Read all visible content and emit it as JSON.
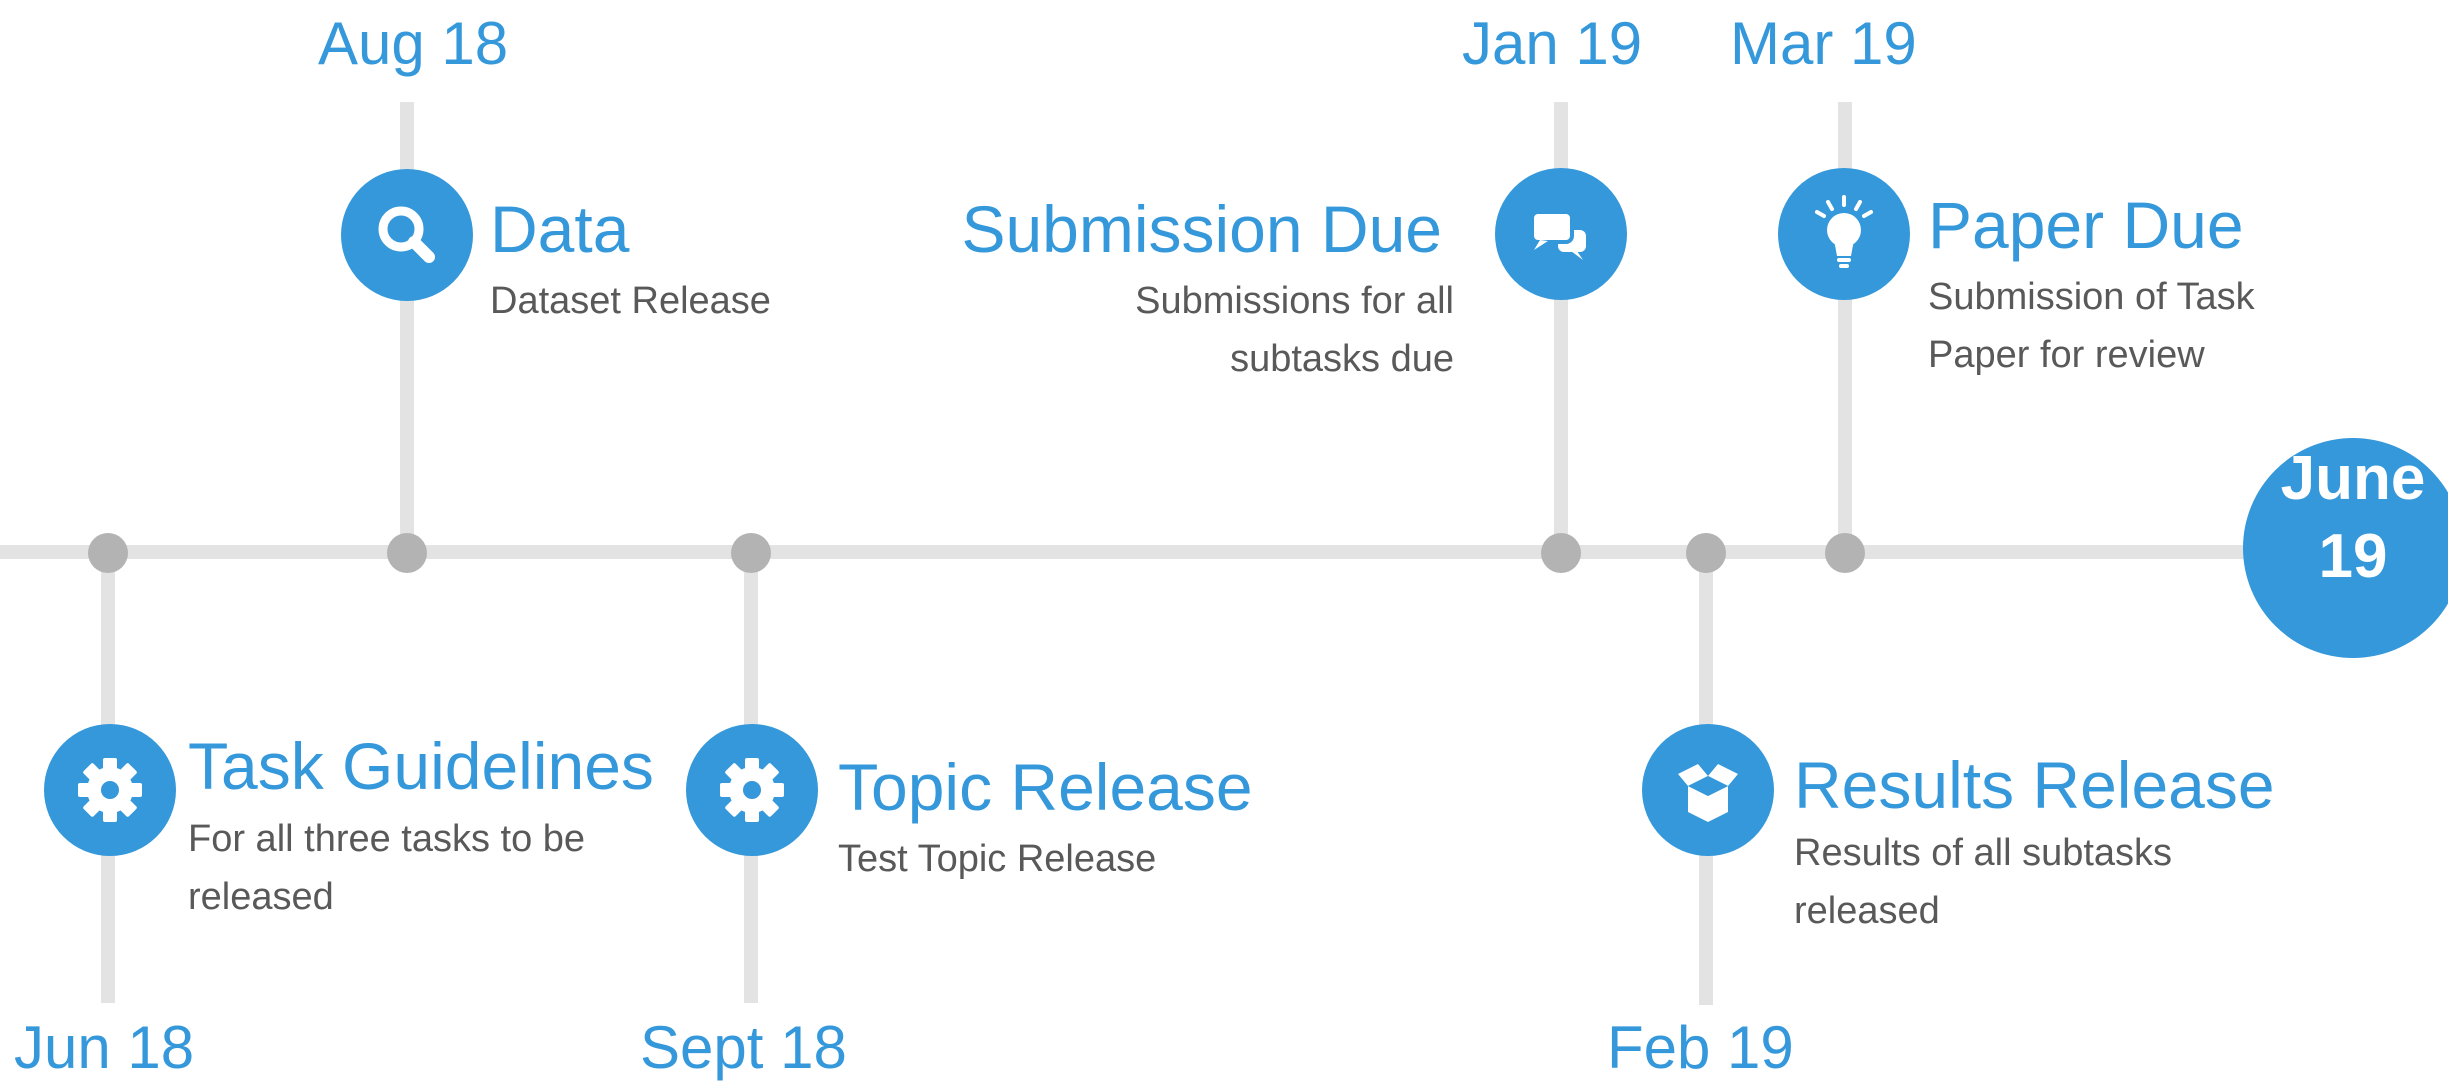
{
  "timeline": {
    "events": [
      {
        "id": "jun18",
        "date": "Jun 18",
        "title": "Task Guidelines",
        "description": "For all three tasks to be released",
        "icon": "gear-icon"
      },
      {
        "id": "aug18",
        "date": "Aug 18",
        "title": "Data",
        "description": "Dataset Release",
        "icon": "search-icon"
      },
      {
        "id": "sept18",
        "date": "Sept 18",
        "title": "Topic Release",
        "description": "Test Topic Release",
        "icon": "gear-icon"
      },
      {
        "id": "jan19",
        "date": "Jan 19",
        "title": "Submission Due",
        "description": "Submissions for all subtasks due",
        "icon": "chat-bubbles-icon"
      },
      {
        "id": "feb19",
        "date": "Feb 19",
        "title": "Results Release",
        "description": "Results of all subtasks released",
        "icon": "open-box-icon"
      },
      {
        "id": "mar19",
        "date": "Mar 19",
        "title": "Paper Due",
        "description": "Submission of Task Paper for review",
        "icon": "lightbulb-icon"
      }
    ],
    "end_marker": {
      "line1": "June",
      "line2": "19"
    }
  },
  "colors": {
    "accent": "#3498db",
    "line": "#e3e3e3",
    "node": "#b3b3b3",
    "description_text": "#595959"
  }
}
